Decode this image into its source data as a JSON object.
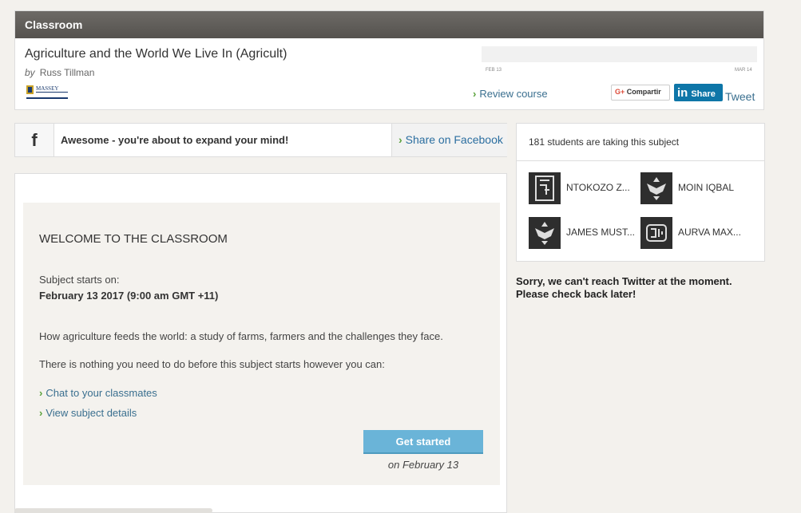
{
  "header": {
    "section_label": "Classroom",
    "course_title": "Agriculture and the World We Live In (Agricult)",
    "by_label": "by",
    "author": "Russ Tillman",
    "logo_text": "MASSEY",
    "date_start": "FEB 13",
    "date_end": "MAR 14",
    "review_course": "Review course",
    "share_google": "Compartir",
    "share_linkedin": "Share",
    "tweet": "Tweet"
  },
  "facebook": {
    "icon": "f",
    "message": "Awesome - you're about to expand your mind!",
    "share_label": "Share on Facebook"
  },
  "students": {
    "count_text": "181 students are taking this subject",
    "list": [
      {
        "name": "NTOKOZO Z..."
      },
      {
        "name": "MOIN IQBAL"
      },
      {
        "name": "JAMES MUST..."
      },
      {
        "name": "AURVA MAX..."
      }
    ]
  },
  "twitter": {
    "message_line1": "Sorry, we can't reach Twitter at the moment.",
    "message_line2": "Please check back later!"
  },
  "welcome": {
    "title": "WELCOME TO THE CLASSROOM",
    "starts_label": "Subject starts on:",
    "starts_date": "February 13 2017 (9:00 am GMT +11)",
    "description": "How agriculture feeds the world: a study of farms, farmers and the challenges they face.",
    "nothing_text": "There is nothing you need to do before this subject starts however you can:",
    "link_chat": "Chat to your classmates",
    "link_details": "View subject details",
    "get_started": "Get started",
    "on_date": "on February 13"
  },
  "colors": {
    "accent_blue": "#6ab4d8",
    "link_blue": "#3a6f8f",
    "chevron_green": "#5aa13b",
    "linkedin": "#0e76a8"
  }
}
